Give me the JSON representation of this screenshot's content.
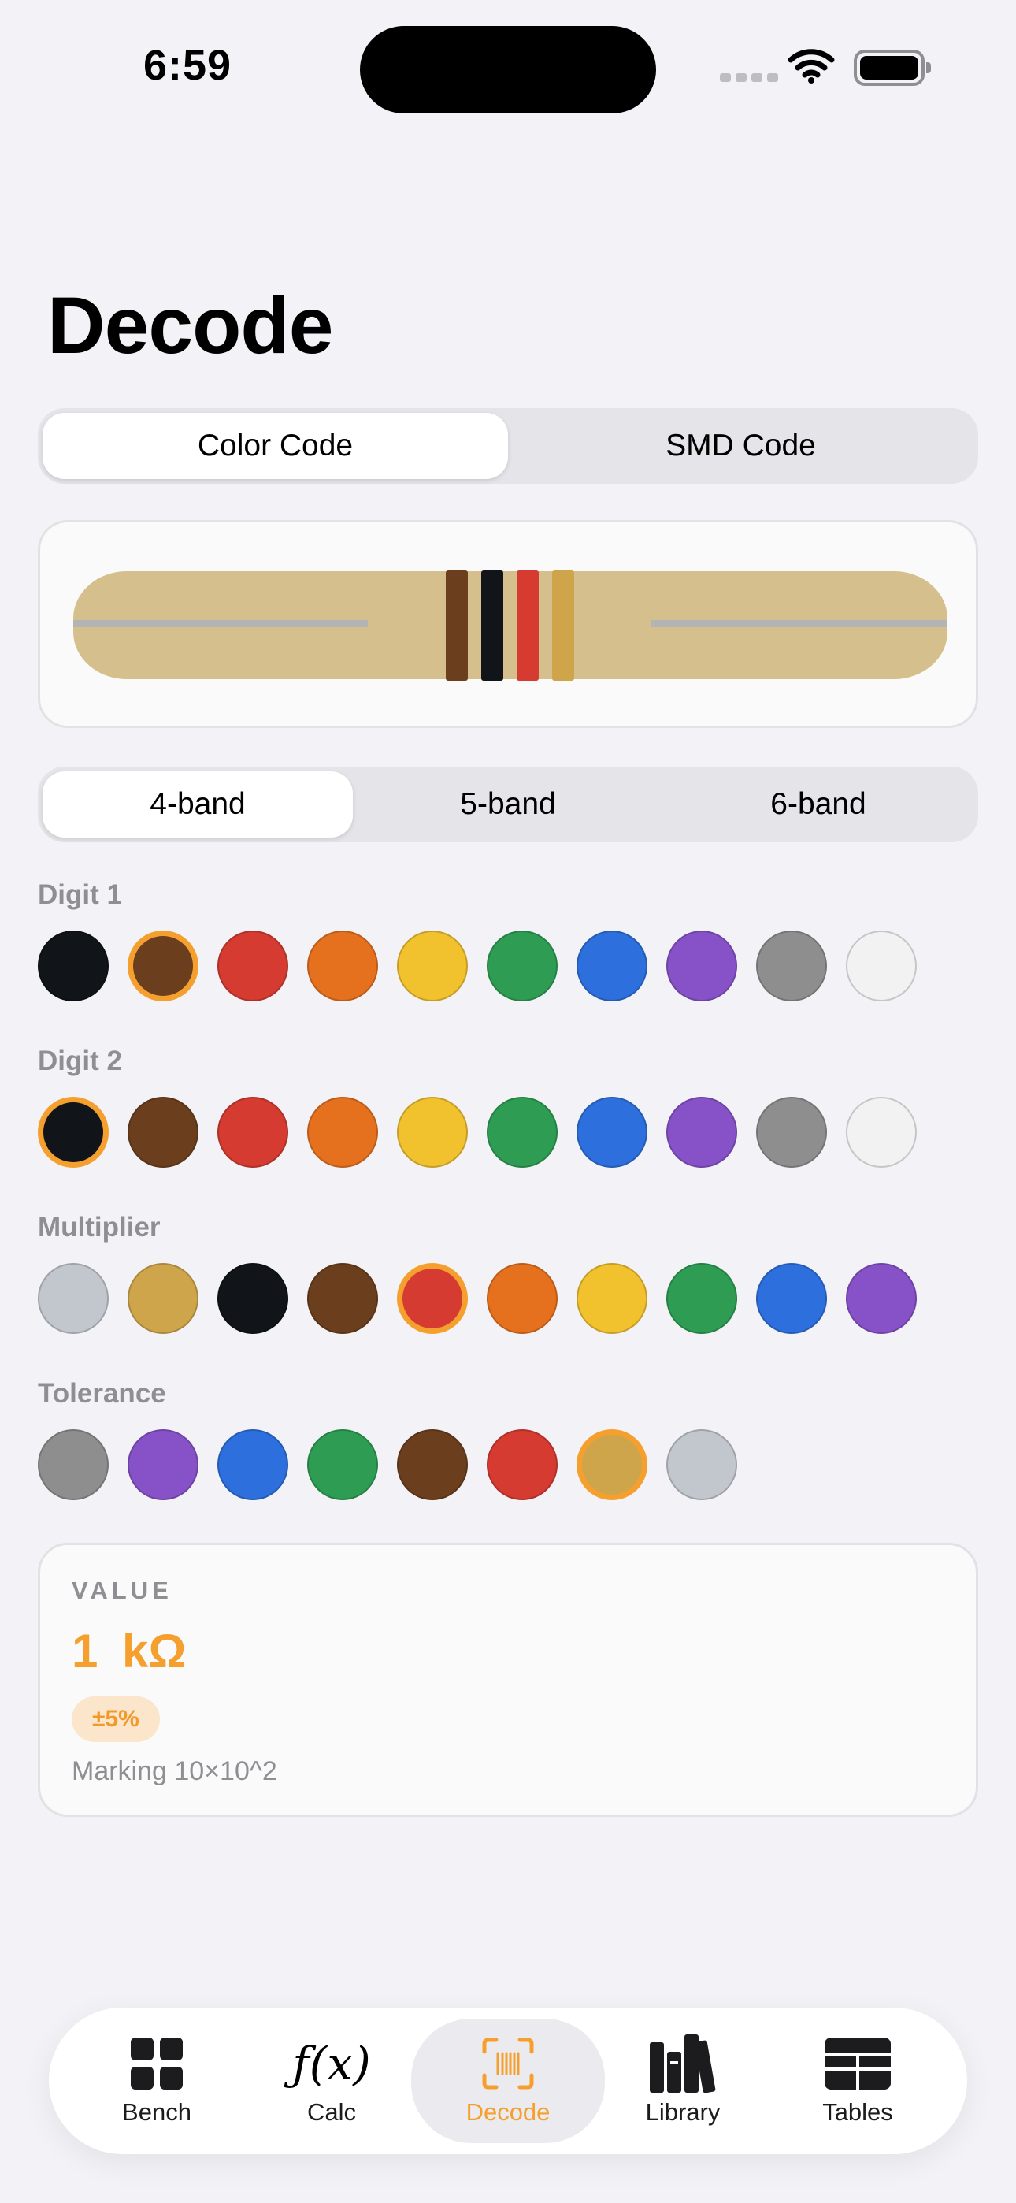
{
  "status_bar": {
    "time": "6:59"
  },
  "title": "Decode",
  "mode_tabs": [
    {
      "label": "Color Code",
      "active": true
    },
    {
      "label": "SMD Code",
      "active": false
    }
  ],
  "resistor_preview": {
    "bands": [
      "#6b3f1d",
      "#111418",
      "#d53b30",
      "#cfa54b"
    ]
  },
  "band_tabs": [
    {
      "label": "4-band",
      "active": true
    },
    {
      "label": "5-band",
      "active": false
    },
    {
      "label": "6-band",
      "active": false
    }
  ],
  "rows": [
    {
      "label": "Digit 1",
      "selected": 1,
      "colors": [
        "#111418",
        "#6b3f1d",
        "#d53b30",
        "#e5711e",
        "#f2c12e",
        "#2e9d53",
        "#2d6fdc",
        "#8752c7",
        "#8e8e8e",
        "#f2f2f2"
      ]
    },
    {
      "label": "Digit 2",
      "selected": 0,
      "colors": [
        "#111418",
        "#6b3f1d",
        "#d53b30",
        "#e5711e",
        "#f2c12e",
        "#2e9d53",
        "#2d6fdc",
        "#8752c7",
        "#8e8e8e",
        "#f2f2f2"
      ]
    },
    {
      "label": "Multiplier",
      "selected": 4,
      "colors": [
        "#c2c6cd",
        "#cfa54b",
        "#111418",
        "#6b3f1d",
        "#d53b30",
        "#e5711e",
        "#f2c12e",
        "#2e9d53",
        "#2d6fdc",
        "#8752c7"
      ]
    },
    {
      "label": "Tolerance",
      "selected": 6,
      "colors": [
        "#8e8e8e",
        "#8752c7",
        "#2d6fdc",
        "#2e9d53",
        "#6b3f1d",
        "#d53b30",
        "#cfa54b",
        "#c2c6cd"
      ]
    }
  ],
  "value": {
    "caption": "VALUE",
    "main": "1 kΩ",
    "tolerance": "±5%",
    "marking": "Marking 10×10^2"
  },
  "tab_bar": [
    {
      "label": "Bench",
      "icon": "grid-icon",
      "active": false
    },
    {
      "label": "Calc",
      "icon": "fx-icon",
      "active": false
    },
    {
      "label": "Decode",
      "icon": "barcode-scan-icon",
      "active": true
    },
    {
      "label": "Library",
      "icon": "books-icon",
      "active": false
    },
    {
      "label": "Tables",
      "icon": "table-icon",
      "active": false
    }
  ],
  "colors": {
    "accent": "#f5a02e",
    "background": "#f2f2f7"
  }
}
